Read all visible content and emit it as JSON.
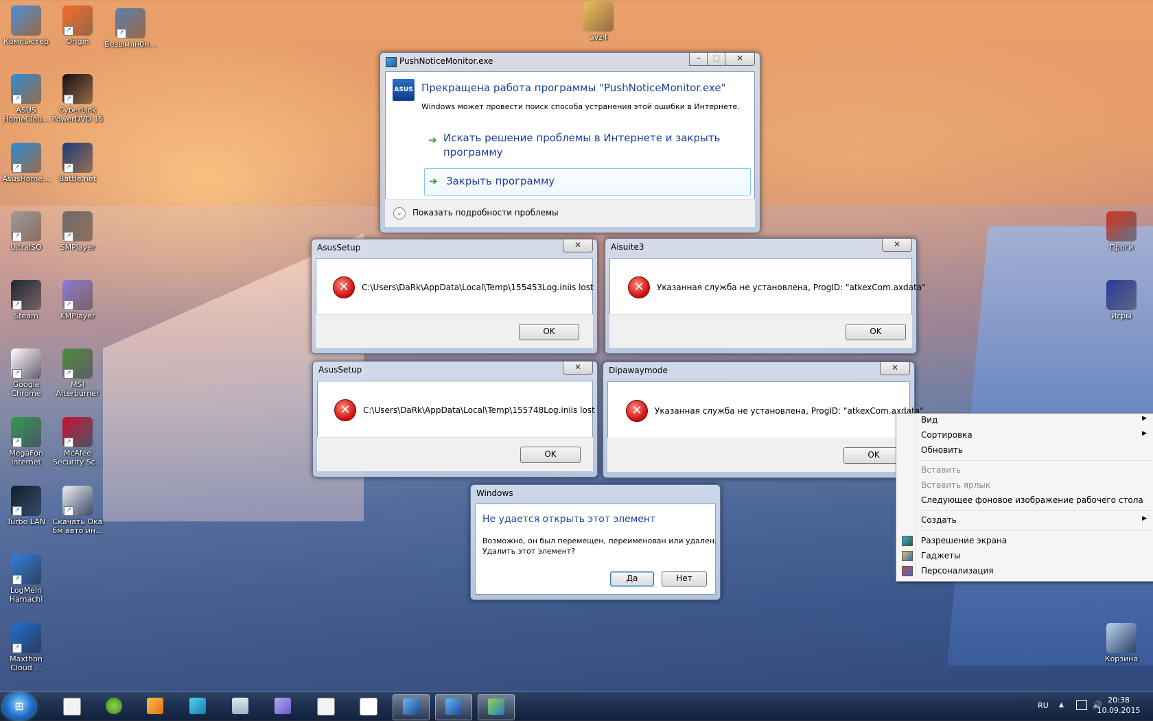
{
  "desktop": {
    "icons": [
      {
        "label": "Компьютер",
        "icon": "computer-icon",
        "color": "#4a8fd8"
      },
      {
        "label": "Origin",
        "icon": "origin-icon",
        "color": "#f56c2d"
      },
      {
        "label": "Безымян0н...",
        "icon": "image-file-icon",
        "color": "#5b7fb0"
      },
      {
        "label": "avz4",
        "icon": "folder-icon",
        "color": "#e8c35a"
      },
      {
        "label": "ASUS HomeClou...",
        "icon": "cloud-icon",
        "color": "#2a8fd6"
      },
      {
        "label": "CyberLink PowerDVD 15",
        "icon": "powerdvd-icon",
        "color": "#111111"
      },
      {
        "label": "AsusHome...",
        "icon": "cloud-icon",
        "color": "#2a8fd6"
      },
      {
        "label": "Battle.net",
        "icon": "battlenet-icon",
        "color": "#1b3c78"
      },
      {
        "label": "UltraISO",
        "icon": "disc-icon",
        "color": "#9a9a9a"
      },
      {
        "label": "SMPlayer",
        "icon": "smplayer-icon",
        "color": "#6b6b6b"
      },
      {
        "label": "Steam",
        "icon": "steam-icon",
        "color": "#1b2838"
      },
      {
        "label": "KMPlayer",
        "icon": "kmplayer-icon",
        "color": "#8a7ad6"
      },
      {
        "label": "Google Chrome",
        "icon": "document-icon",
        "color": "#ffffff"
      },
      {
        "label": "MSI Afterburner",
        "icon": "afterburner-icon",
        "color": "#4a8a3a"
      },
      {
        "label": "MegaFon Internet",
        "icon": "megafon-icon",
        "color": "#2e9a4a"
      },
      {
        "label": "McAfee Security Sc...",
        "icon": "mcafee-icon",
        "color": "#c8102e"
      },
      {
        "label": "Turbo LAN",
        "icon": "turbolan-icon",
        "color": "#0c1f2c"
      },
      {
        "label": "Скачать Ока 6м авто ин...",
        "icon": "html-file-icon",
        "color": "#f0f0f0"
      },
      {
        "label": "LogMeIn Hamachi",
        "icon": "hamachi-icon",
        "color": "#2e7fd8"
      },
      {
        "label": "Maxthon Cloud ...",
        "icon": "maxthon-icon",
        "color": "#1f6fd2"
      },
      {
        "label": "Проги",
        "icon": "programs-icon",
        "color": "#c83a2a"
      },
      {
        "label": "Игры",
        "icon": "games-icon",
        "color": "#2a3a9a"
      },
      {
        "label": "Корзина",
        "icon": "recycle-bin-icon",
        "color": "#bcd4ea"
      }
    ]
  },
  "push_dialog": {
    "title": "PushNoticeMonitor.exe",
    "heading": "Прекращена работа программы \"PushNoticeMonitor.exe\"",
    "subtext": "Windows может провести поиск способа устранения этой ошибки в Интернете.",
    "option1_line1": "Искать решение проблемы в Интернете и закрыть",
    "option1_line2": "программу",
    "option2": "Закрыть программу",
    "details": "Показать подробности проблемы",
    "logo_text": "ASUS"
  },
  "asus1": {
    "title": "AsusSetup",
    "message": "C:\\Users\\DaRk\\AppData\\Local\\Temp\\155453Log.iniis lost",
    "ok": "OK"
  },
  "aisuite": {
    "title": "Aisuite3",
    "message": "Указанная служба не установлена, ProgID: \"atkexCom.axdata\"",
    "ok": "OK"
  },
  "asus2": {
    "title": "AsusSetup",
    "message": "C:\\Users\\DaRk\\AppData\\Local\\Temp\\155748Log.iniis lost",
    "ok": "OK"
  },
  "dipaway": {
    "title": "Dipawaymode",
    "message": "Указанная служба не установлена, ProgID: \"atkexCom.axdata\"",
    "ok": "OK"
  },
  "windows_dialog": {
    "title": "Windows",
    "heading": "Не удается открыть этот элемент",
    "line1": "Возможно, он был перемещен, переименован или удален.",
    "line2": "Удалить этот элемент?",
    "yes": "Да",
    "no": "Нет"
  },
  "context_menu": {
    "view": "Вид",
    "sort": "Сортировка",
    "refresh": "Обновить",
    "paste": "Вставить",
    "paste_shortcut": "Вставить ярлык",
    "next_bg": "Следующее фоновое изображение рабочего стола",
    "create": "Создать",
    "resolution": "Разрешение экрана",
    "gadgets": "Гаджеты",
    "personalize": "Персонализация"
  },
  "taskbar": {
    "lang": "RU",
    "time": "20:38",
    "date": "10.09.2015"
  },
  "colors": {
    "title_blue": "#1e3f9c",
    "link_green": "#2a9a3a",
    "error_red": "#d41a1a"
  }
}
